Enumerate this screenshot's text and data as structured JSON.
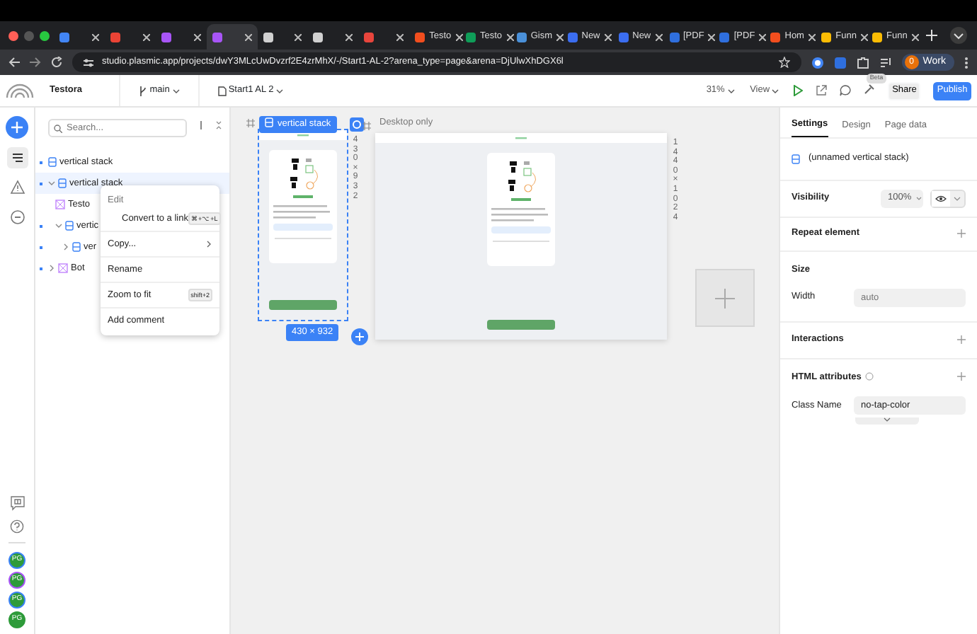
{
  "browser": {
    "tabs": [
      {
        "color": "#4285f4",
        "selected": false
      },
      {
        "color": "#ea4335",
        "selected": false
      },
      {
        "color": "#a855f7",
        "selected": false
      },
      {
        "color": "#a855f7",
        "selected": true
      },
      {
        "color": "#d0d0d0",
        "selected": false
      },
      {
        "color": "#d0d0d0",
        "selected": false
      },
      {
        "color": "#e8453c",
        "selected": false
      },
      {
        "title": "Testo",
        "color": "#f24e1e",
        "selected": false
      },
      {
        "title": "Testo",
        "color": "#0f9d58",
        "selected": false
      },
      {
        "title": "Gism",
        "color": "#4a90d9",
        "selected": false
      },
      {
        "title": "New",
        "color": "#3b6df0",
        "selected": false
      },
      {
        "title": "New",
        "color": "#3b6df0",
        "selected": false
      },
      {
        "title": "[PDF",
        "color": "#2f6fde",
        "selected": false
      },
      {
        "title": "[PDF",
        "color": "#2f6fde",
        "selected": false
      },
      {
        "title": "Hom",
        "color": "#f24e1e",
        "selected": false
      },
      {
        "title": "Funn",
        "color": "#fbbc04",
        "selected": false
      },
      {
        "title": "Funn",
        "color": "#fbbc04",
        "selected": false
      }
    ],
    "url": "studio.plasmic.app/projects/dwY3MLcUwDvzrf2E4zrMhX/-/Start1-AL-2?arena_type=page&arena=DjUlwXhDGX6l",
    "profile": {
      "initial": "0",
      "label": "Work"
    }
  },
  "toolbar": {
    "project": "Testora",
    "branch": "main",
    "page": "Start1 AL 2",
    "zoom": "31%",
    "view": "View",
    "beta": "Beta",
    "share": "Share",
    "publish": "Publish"
  },
  "rail": {
    "tools": [
      {
        "kind": "layers",
        "selected": true
      },
      {
        "kind": "warning",
        "selected": false
      },
      {
        "kind": "minus",
        "selected": false
      }
    ],
    "avatars": [
      {
        "initials": "PG",
        "color": "#3b82f6"
      },
      {
        "initials": "PG",
        "color": "#a855f7"
      },
      {
        "initials": "PG",
        "color": "#3b82f6"
      },
      {
        "initials": "PG",
        "color": "#2e9b3a"
      }
    ]
  },
  "tree": {
    "search": {
      "placeholder": "Search..."
    },
    "items": [
      {
        "label": "vertical stack",
        "kind": "stack",
        "marked": true,
        "selected": false
      },
      {
        "label": "vertical stack",
        "kind": "stack",
        "marked": true,
        "selected": true,
        "expanded": true,
        "children": [
          {
            "label": "Testo",
            "kind": "component",
            "marked": false,
            "selected": false
          },
          {
            "label": "vertic",
            "kind": "stack",
            "marked": true,
            "selected": false,
            "expanded": true,
            "children": [
              {
                "label": "ver",
                "kind": "stack",
                "marked": true,
                "selected": false,
                "expanded": false
              }
            ]
          }
        ]
      },
      {
        "label": "Bot",
        "kind": "component",
        "marked": true,
        "selected": false,
        "expanded": false
      }
    ]
  },
  "context_menu": {
    "groups": [
      [
        {
          "kind": "heading",
          "label": "Edit"
        },
        {
          "kind": "action",
          "label": "Convert to a link",
          "shortcut": "⌘+⌥+L"
        }
      ],
      [
        {
          "kind": "action",
          "label": "Copy...",
          "submenu": true
        }
      ],
      [
        {
          "kind": "action",
          "label": "Rename"
        }
      ],
      [
        {
          "kind": "action",
          "label": "Zoom to fit",
          "shortcut": "shift+2"
        }
      ],
      [
        {
          "kind": "action",
          "label": "Add comment"
        }
      ]
    ]
  },
  "canvas": {
    "artboards": [
      {
        "selected": true,
        "label": "vertical stack",
        "size": "430 × 932",
        "bottom_size": "430 × 932"
      },
      {
        "selected": false,
        "label": "Desktop only",
        "size": "1440 × 1024"
      }
    ]
  },
  "inspector": {
    "tabs": [
      {
        "label": "Settings",
        "selected": true
      },
      {
        "label": "Design",
        "selected": false
      },
      {
        "label": "Page data",
        "selected": false
      }
    ],
    "element": "(unnamed vertical stack)",
    "visibility": {
      "label": "Visibility",
      "value": "100%"
    },
    "repeat": "Repeat element",
    "size": {
      "heading": "Size",
      "label": "Width",
      "placeholder": "auto"
    },
    "interactions": "Interactions",
    "html": {
      "heading": "HTML attributes",
      "label": "Class Name",
      "value": "no-tap-color"
    }
  }
}
